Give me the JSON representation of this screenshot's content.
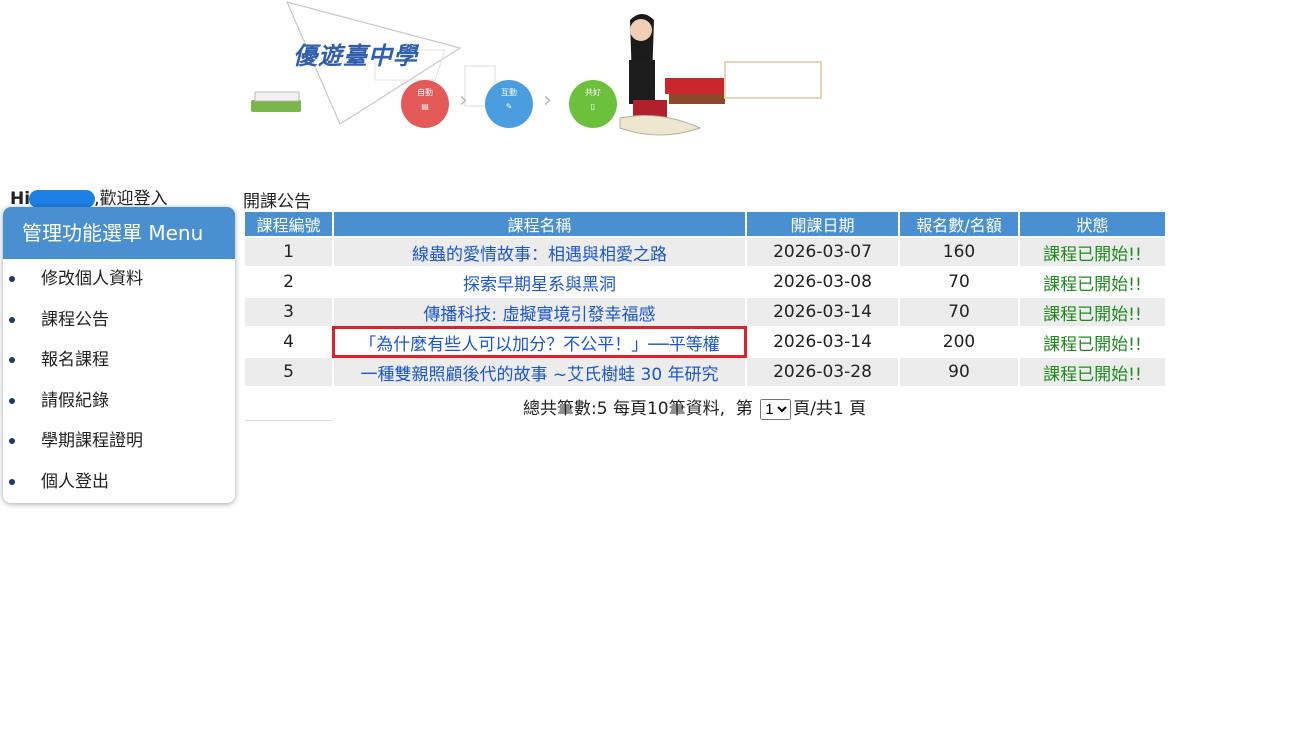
{
  "banner": {
    "title": "優遊臺中學",
    "circles": [
      "自動",
      "互動",
      "共好"
    ]
  },
  "greeting": {
    "hi": "Hi",
    "welcome": ",歡迎登入"
  },
  "menu": {
    "header": "管理功能選單 Menu",
    "items": [
      "修改個人資料",
      "課程公告",
      "報名課程",
      "請假紀錄",
      "學期課程證明",
      "個人登出"
    ]
  },
  "main": {
    "title": "開課公告",
    "columns": [
      "課程編號",
      "課程名稱",
      "開課日期",
      "報名數/名額",
      "狀態"
    ],
    "rows": [
      {
        "id": "1",
        "name": "線蟲的愛情故事：相遇與相愛之路",
        "date": "2026-03-07",
        "count": "160",
        "status": "課程已開始!!"
      },
      {
        "id": "2",
        "name": "探索早期星系與黑洞",
        "date": "2026-03-08",
        "count": "70",
        "status": "課程已開始!!"
      },
      {
        "id": "3",
        "name": "傳播科技: 虛擬實境引發幸福感",
        "date": "2026-03-14",
        "count": "70",
        "status": "課程已開始!!"
      },
      {
        "id": "4",
        "name": "「為什麼有些人可以加分？不公平！」──平等權",
        "date": "2026-03-14",
        "count": "200",
        "status": "課程已開始!!"
      },
      {
        "id": "5",
        "name": "一種雙親照顧後代的故事 ~艾氏樹蛙 30 年研究",
        "date": "2026-03-28",
        "count": "90",
        "status": "課程已開始!!"
      }
    ],
    "pager": {
      "prefix": "總共筆數:5 每頁10筆資料,  第 ",
      "page": "1",
      "suffix": "頁/共1 頁"
    }
  },
  "colors": {
    "header_blue": "#4a90d0",
    "link_blue": "#1a56d6",
    "status_green": "#1e8a1e",
    "highlight_red": "#e0202a"
  }
}
